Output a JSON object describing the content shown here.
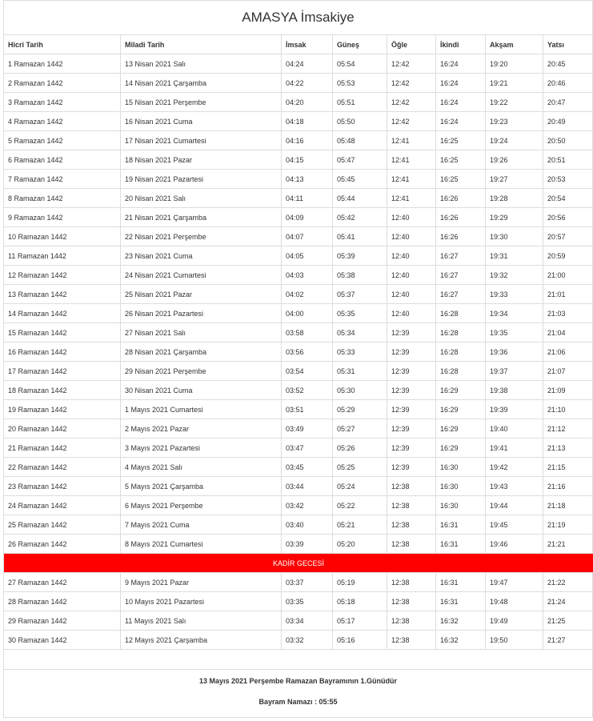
{
  "title": "AMASYA İmsakiye",
  "headers": [
    "Hicri Tarih",
    "Miladi Tarih",
    "İmsak",
    "Güneş",
    "Öğle",
    "İkindi",
    "Akşam",
    "Yatsı"
  ],
  "rows": [
    [
      "1 Ramazan 1442",
      "13 Nisan 2021 Salı",
      "04:24",
      "05:54",
      "12:42",
      "16:24",
      "19:20",
      "20:45"
    ],
    [
      "2 Ramazan 1442",
      "14 Nisan 2021 Çarşamba",
      "04:22",
      "05:53",
      "12:42",
      "16:24",
      "19:21",
      "20:46"
    ],
    [
      "3 Ramazan 1442",
      "15 Nisan 2021 Perşembe",
      "04:20",
      "05:51",
      "12:42",
      "16:24",
      "19:22",
      "20:47"
    ],
    [
      "4 Ramazan 1442",
      "16 Nisan 2021 Cuma",
      "04:18",
      "05:50",
      "12:42",
      "16:24",
      "19:23",
      "20:49"
    ],
    [
      "5 Ramazan 1442",
      "17 Nisan 2021 Cumartesi",
      "04:16",
      "05:48",
      "12:41",
      "16:25",
      "19:24",
      "20:50"
    ],
    [
      "6 Ramazan 1442",
      "18 Nisan 2021 Pazar",
      "04:15",
      "05:47",
      "12:41",
      "16:25",
      "19:26",
      "20:51"
    ],
    [
      "7 Ramazan 1442",
      "19 Nisan 2021 Pazartesi",
      "04:13",
      "05:45",
      "12:41",
      "16:25",
      "19:27",
      "20:53"
    ],
    [
      "8 Ramazan 1442",
      "20 Nisan 2021 Salı",
      "04:11",
      "05:44",
      "12:41",
      "16:26",
      "19:28",
      "20:54"
    ],
    [
      "9 Ramazan 1442",
      "21 Nisan 2021 Çarşamba",
      "04:09",
      "05:42",
      "12:40",
      "16:26",
      "19:29",
      "20:56"
    ],
    [
      "10 Ramazan 1442",
      "22 Nisan 2021 Perşembe",
      "04:07",
      "05:41",
      "12:40",
      "16:26",
      "19:30",
      "20:57"
    ],
    [
      "11 Ramazan 1442",
      "23 Nisan 2021 Cuma",
      "04:05",
      "05:39",
      "12:40",
      "16:27",
      "19:31",
      "20:59"
    ],
    [
      "12 Ramazan 1442",
      "24 Nisan 2021 Cumartesi",
      "04:03",
      "05:38",
      "12:40",
      "16:27",
      "19:32",
      "21:00"
    ],
    [
      "13 Ramazan 1442",
      "25 Nisan 2021 Pazar",
      "04:02",
      "05:37",
      "12:40",
      "16:27",
      "19:33",
      "21:01"
    ],
    [
      "14 Ramazan 1442",
      "26 Nisan 2021 Pazartesi",
      "04:00",
      "05:35",
      "12:40",
      "16:28",
      "19:34",
      "21:03"
    ],
    [
      "15 Ramazan 1442",
      "27 Nisan 2021 Salı",
      "03:58",
      "05:34",
      "12:39",
      "16:28",
      "19:35",
      "21:04"
    ],
    [
      "16 Ramazan 1442",
      "28 Nisan 2021 Çarşamba",
      "03:56",
      "05:33",
      "12:39",
      "16:28",
      "19:36",
      "21:06"
    ],
    [
      "17 Ramazan 1442",
      "29 Nisan 2021 Perşembe",
      "03:54",
      "05:31",
      "12:39",
      "16:28",
      "19:37",
      "21:07"
    ],
    [
      "18 Ramazan 1442",
      "30 Nisan 2021 Cuma",
      "03:52",
      "05:30",
      "12:39",
      "16:29",
      "19:38",
      "21:09"
    ],
    [
      "19 Ramazan 1442",
      "1 Mayıs 2021 Cumartesi",
      "03:51",
      "05:29",
      "12:39",
      "16:29",
      "19:39",
      "21:10"
    ],
    [
      "20 Ramazan 1442",
      "2 Mayıs 2021 Pazar",
      "03:49",
      "05:27",
      "12:39",
      "16:29",
      "19:40",
      "21:12"
    ],
    [
      "21 Ramazan 1442",
      "3 Mayıs 2021 Pazartesi",
      "03:47",
      "05:26",
      "12:39",
      "16:29",
      "19:41",
      "21:13"
    ],
    [
      "22 Ramazan 1442",
      "4 Mayıs 2021 Salı",
      "03:45",
      "05:25",
      "12:39",
      "16:30",
      "19:42",
      "21:15"
    ],
    [
      "23 Ramazan 1442",
      "5 Mayıs 2021 Çarşamba",
      "03:44",
      "05:24",
      "12:38",
      "16:30",
      "19:43",
      "21:16"
    ],
    [
      "24 Ramazan 1442",
      "6 Mayıs 2021 Perşembe",
      "03:42",
      "05:22",
      "12:38",
      "16:30",
      "19:44",
      "21:18"
    ],
    [
      "25 Ramazan 1442",
      "7 Mayıs 2021 Cuma",
      "03:40",
      "05:21",
      "12:38",
      "16:31",
      "19:45",
      "21:19"
    ],
    [
      "26 Ramazan 1442",
      "8 Mayıs 2021 Cumartesi",
      "03:39",
      "05:20",
      "12:38",
      "16:31",
      "19:46",
      "21:21"
    ]
  ],
  "special_row": "KADİR GECESİ",
  "rows_after": [
    [
      "27 Ramazan 1442",
      "9 Mayıs 2021 Pazar",
      "03:37",
      "05:19",
      "12:38",
      "16:31",
      "19:47",
      "21:22"
    ],
    [
      "28 Ramazan 1442",
      "10 Mayıs 2021 Pazartesi",
      "03:35",
      "05:18",
      "12:38",
      "16:31",
      "19:48",
      "21:24"
    ],
    [
      "29 Ramazan 1442",
      "11 Mayıs 2021 Salı",
      "03:34",
      "05:17",
      "12:38",
      "16:32",
      "19:49",
      "21:25"
    ],
    [
      "30 Ramazan 1442",
      "12 Mayıs 2021 Çarşamba",
      "03:32",
      "05:16",
      "12:38",
      "16:32",
      "19:50",
      "21:27"
    ]
  ],
  "footer": {
    "bayram_note": "13 Mayıs 2021 Perşembe Ramazan Bayramının 1.Günüdür",
    "bayram_namazi": "Bayram Namazı : 05:55"
  },
  "colors": {
    "special_row_bg": "#ff0000",
    "border": "#dddddd"
  }
}
